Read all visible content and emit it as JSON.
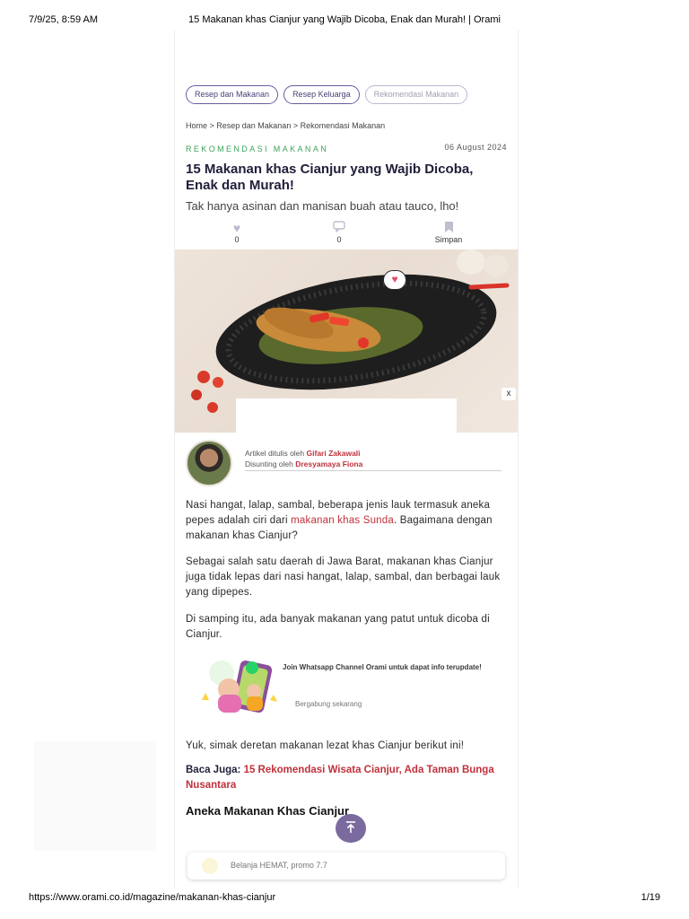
{
  "print": {
    "datetime": "7/9/25, 8:59 AM",
    "doc_title": "15 Makanan khas Cianjur yang Wajib Dicoba, Enak dan Murah! | Orami",
    "url": "https://www.orami.co.id/magazine/makanan-khas-cianjur",
    "page": "1/19"
  },
  "chips": [
    "Resep dan Makanan",
    "Resep Keluarga",
    "Rekomendasi Makanan"
  ],
  "breadcrumb": "Home > Resep dan Makanan > Rekomendasi Makanan",
  "article": {
    "category": "REKOMENDASI MAKANAN",
    "date": "06 August 2024",
    "title": "15 Makanan khas Cianjur yang Wajib Dicoba, Enak dan Murah!",
    "subtitle": "Tak hanya asinan dan manisan buah atau tauco, lho!"
  },
  "actions": {
    "like_icon": "heart-icon",
    "like_count": "0",
    "comment_icon": "comment-icon",
    "comment_count": "0",
    "save_icon": "bookmark-icon",
    "save_label": "Simpan"
  },
  "hero": {
    "heart_badge_icon": "heart-bubble-icon",
    "close_label": "x"
  },
  "author": {
    "written_prefix": "Artikel ditulis oleh ",
    "writer": "Gifari Zakawali",
    "edited_prefix": "Disunting oleh ",
    "editor": "Dresyamaya Fiona"
  },
  "body": {
    "p1_a": "Nasi hangat, lalap, sambal, beberapa jenis lauk termasuk aneka pepes adalah ciri dari ",
    "p1_link": "makanan khas Sunda",
    "p1_b": ". Bagaimana dengan makanan khas Cianjur?",
    "p2": "Sebagai salah satu daerah di Jawa Barat, makanan khas Cianjur juga tidak lepas dari nasi hangat, lalap, sambal, dan berbagai lauk yang dipepes.",
    "p3": "Di samping itu, ada banyak makanan yang patut untuk dicoba di Cianjur.",
    "p4": "Yuk, simak deretan makanan lezat khas Cianjur berikut ini!",
    "baca_label": "Baca Juga: ",
    "baca_link": "15 Rekomendasi Wisata Cianjur, Ada Taman Bunga Nusantara",
    "section_title": "Aneka Makanan Khas Cianjur"
  },
  "whatsapp": {
    "title": "Join Whatsapp Channel Orami untuk dapat info terupdate!",
    "cta": "Bergabung sekarang"
  },
  "scroll_top_icon": "arrow-up-icon",
  "promo": {
    "text": "Belanja HEMAT, promo 7.7"
  },
  "colors": {
    "accent_purple": "#6c5b9e",
    "category_green": "#3aa35a",
    "link_red": "#c0313c"
  }
}
